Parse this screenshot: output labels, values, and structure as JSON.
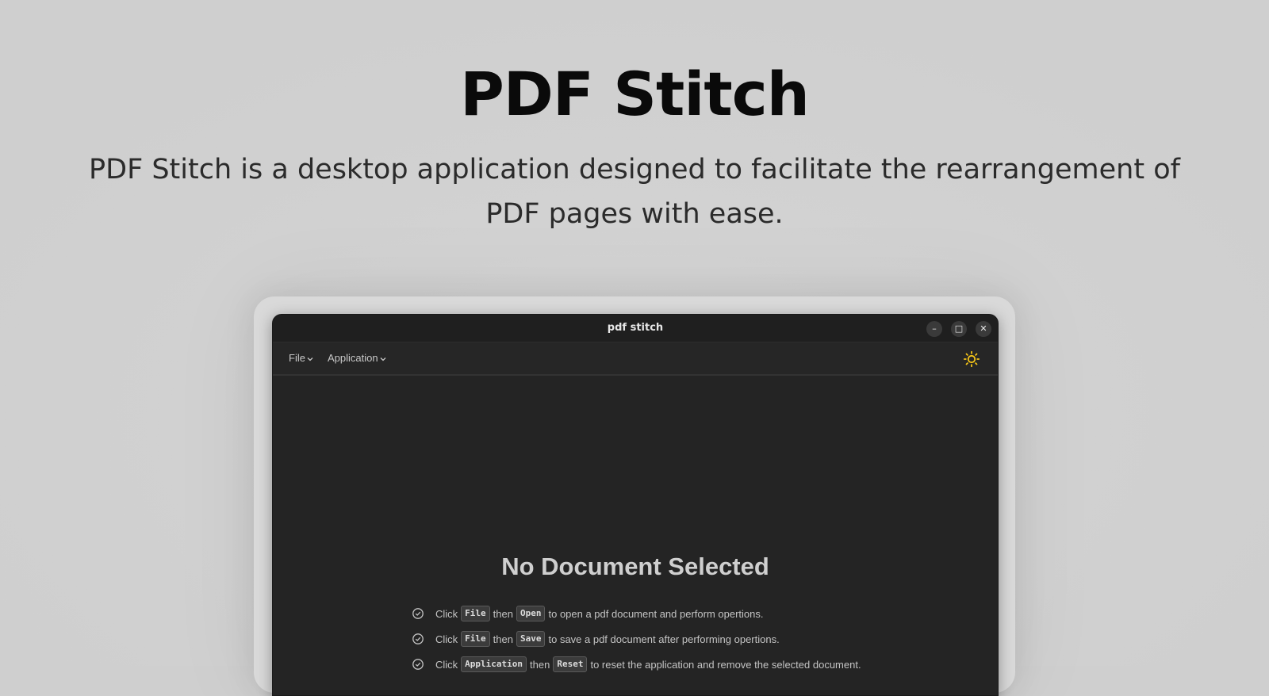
{
  "hero": {
    "title": "PDF Stitch",
    "subtitle": "PDF Stitch is a desktop application designed to facilitate the rearrangement of PDF pages with ease."
  },
  "window": {
    "title": "pdf stitch",
    "controls": {
      "minimize": "–",
      "maximize": "□",
      "close": "✕"
    }
  },
  "menubar": {
    "file_label": "File",
    "application_label": "Application",
    "theme_icon": "sun-icon",
    "theme_icon_color": "#f5c518"
  },
  "empty_state": {
    "title": "No Document Selected",
    "instructions": [
      {
        "pre": "Click",
        "key1": "File",
        "mid": "then",
        "key2": "Open",
        "post": "to open a pdf document and perform opertions."
      },
      {
        "pre": "Click",
        "key1": "File",
        "mid": "then",
        "key2": "Save",
        "post": "to save a pdf document after performing opertions."
      },
      {
        "pre": "Click",
        "key1": "Application",
        "mid": "then",
        "key2": "Reset",
        "post": "to reset the application and remove the selected document."
      }
    ]
  }
}
